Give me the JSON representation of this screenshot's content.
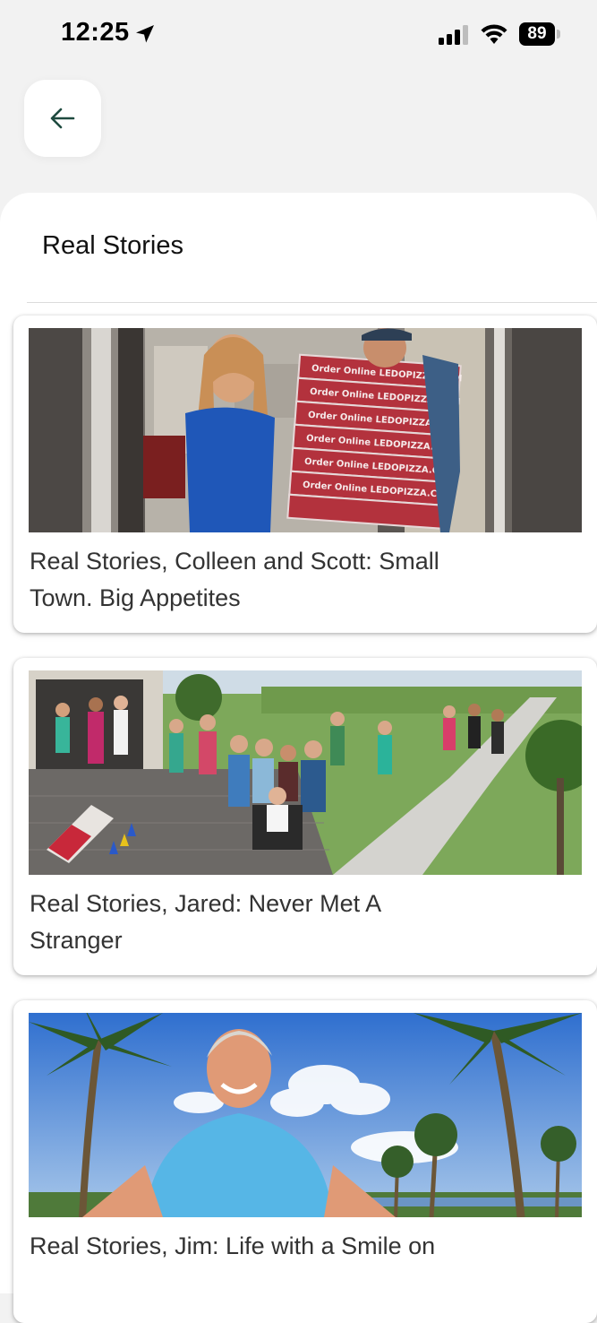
{
  "status_bar": {
    "time": "12:25",
    "battery": "89",
    "icons": [
      "location-arrow-icon",
      "cellular-signal-icon",
      "wifi-icon",
      "battery-icon"
    ]
  },
  "header": {
    "back_icon": "arrow-left-icon",
    "title": "Real Stories"
  },
  "stories": [
    {
      "title": "Real Stories, Colleen and Scott: Small Town. Big Appetites",
      "box_text": "Order Online LEDOPIZZA.COM"
    },
    {
      "title": "Real Stories, Jared: Never Met A Stranger"
    },
    {
      "title": "Real Stories, Jim: Life with a Smile on"
    }
  ],
  "colors": {
    "accent": "#1e4a3f",
    "sheet": "#ffffff",
    "background": "#f2f2f2",
    "text": "#333333"
  }
}
